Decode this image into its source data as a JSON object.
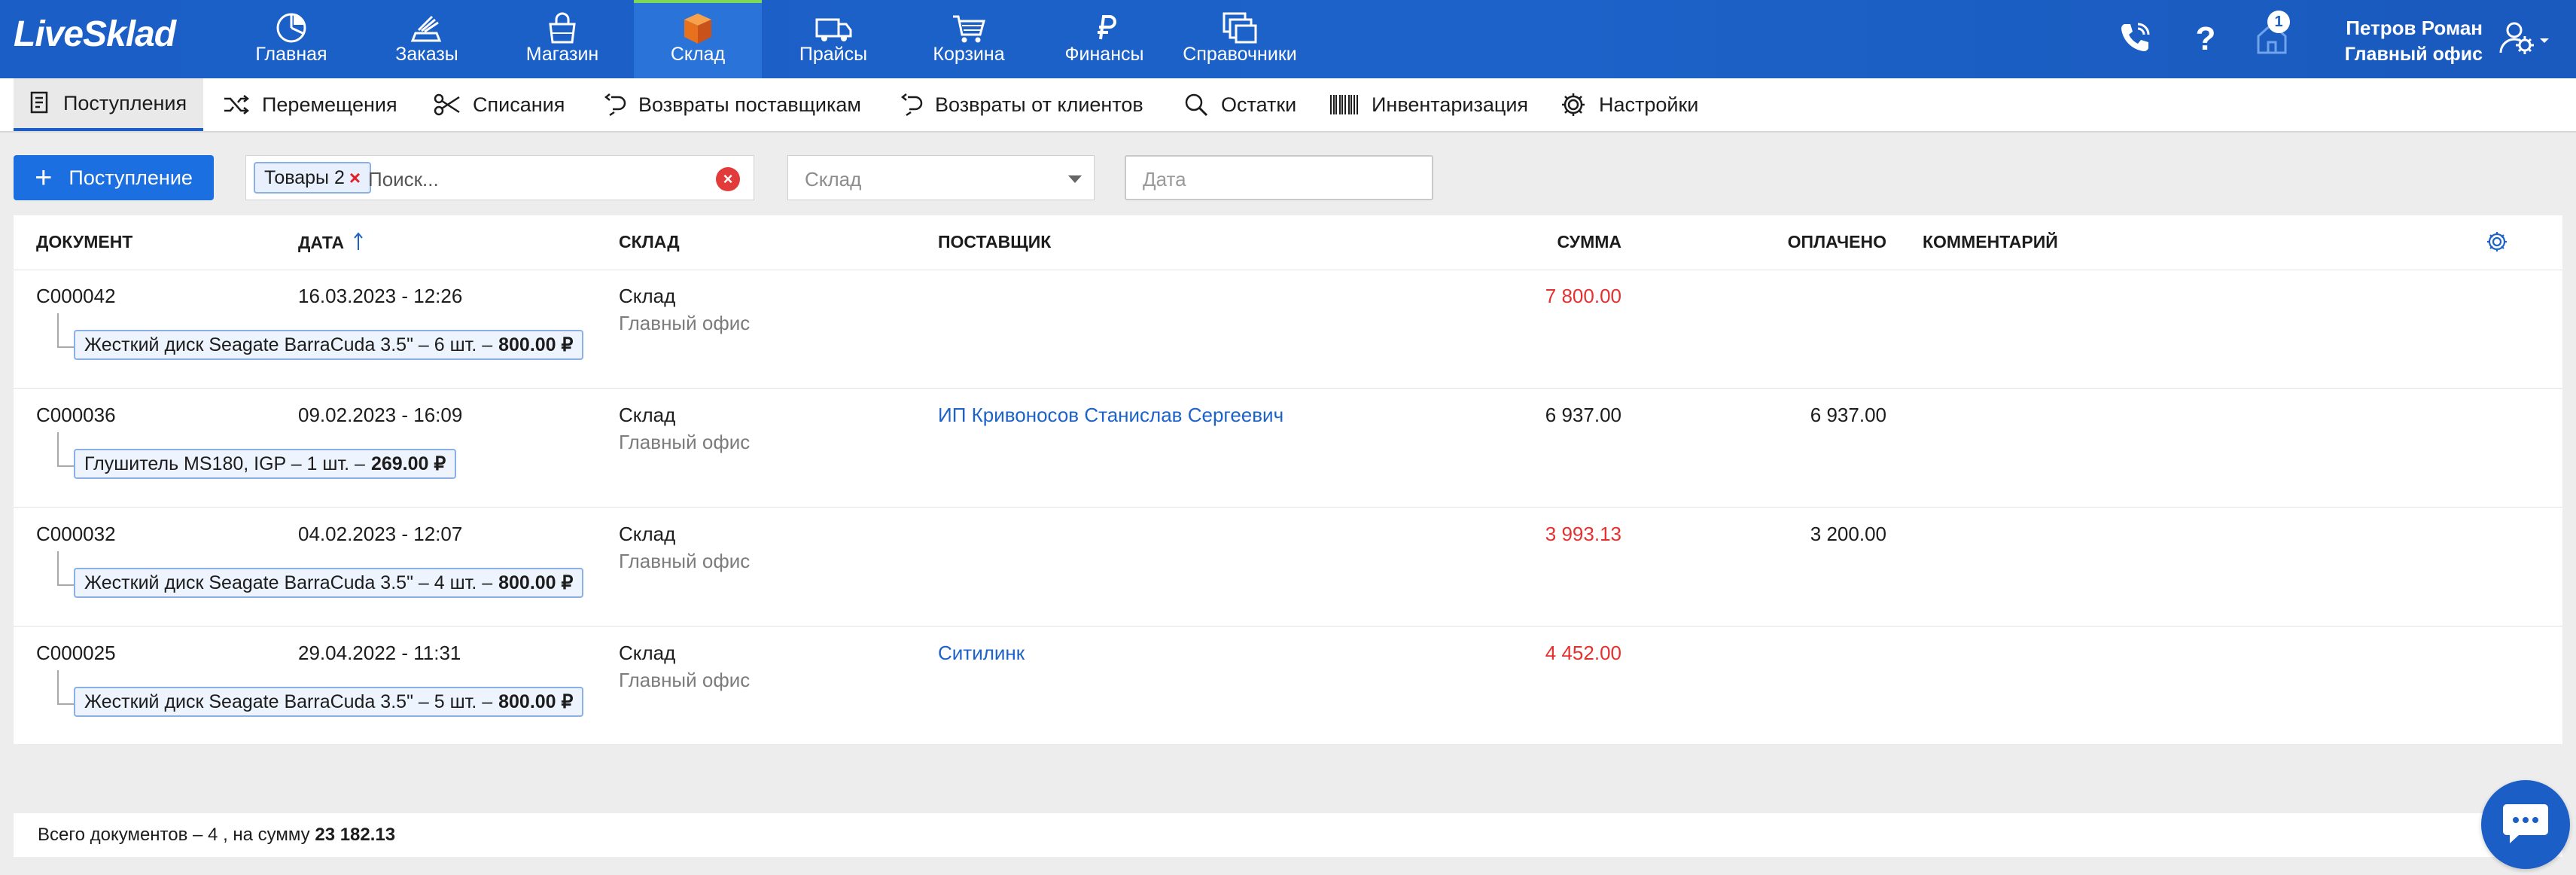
{
  "brand": {
    "logo": "LiveSklad"
  },
  "top_nav": [
    {
      "label": "Главная",
      "icon": "pie-chart-icon"
    },
    {
      "label": "Заказы",
      "icon": "orders-icon"
    },
    {
      "label": "Магазин",
      "icon": "shopping-bag-icon"
    },
    {
      "label": "Склад",
      "icon": "box-icon",
      "active": true
    },
    {
      "label": "Прайсы",
      "icon": "truck-icon"
    },
    {
      "label": "Корзина",
      "icon": "cart-icon"
    },
    {
      "label": "Финансы",
      "icon": "ruble-icon"
    },
    {
      "label": "Справочники",
      "icon": "stacked-windows-icon"
    }
  ],
  "header": {
    "notification_count": "1",
    "user_name": "Петров Роман",
    "user_office": "Главный офис"
  },
  "sub_nav": [
    {
      "label": "Поступления",
      "icon": "document-icon",
      "active": true
    },
    {
      "label": "Перемещения",
      "icon": "shuffle-icon"
    },
    {
      "label": "Списания",
      "icon": "scissors-icon"
    },
    {
      "label": "Возвраты поставщикам",
      "icon": "return-arrow-icon"
    },
    {
      "label": "Возвраты от клиентов",
      "icon": "return-arrow-icon"
    },
    {
      "label": "Остатки",
      "icon": "search-icon"
    },
    {
      "label": "Инвентаризация",
      "icon": "barcode-icon"
    },
    {
      "label": "Настройки",
      "icon": "gear-icon"
    }
  ],
  "toolbar": {
    "add_label": "Поступление",
    "filter_chip": "Товары 2",
    "search_placeholder": "Поиск...",
    "warehouse_placeholder": "Склад",
    "date_placeholder": "Дата"
  },
  "table": {
    "columns": {
      "document": "ДОКУМЕНТ",
      "date": "ДАТА",
      "warehouse": "СКЛАД",
      "supplier": "ПОСТАВЩИК",
      "sum": "СУММА",
      "paid": "ОПЛАЧЕНО",
      "comment": "КОММЕНТАРИЙ"
    },
    "rows": [
      {
        "doc": "C000042",
        "date": "16.03.2023 - 12:26",
        "warehouse": "Склад",
        "office": "Главный офис",
        "supplier": "",
        "sum": "7 800.00",
        "paid": "",
        "item_text": "Жесткий диск Seagate BarraCuda 3.5\" – 6 шт. –",
        "item_price": "800.00 ₽"
      },
      {
        "doc": "C000036",
        "date": "09.02.2023 - 16:09",
        "warehouse": "Склад",
        "office": "Главный офис",
        "supplier": "ИП Кривоносов Станислав Сергеевич",
        "sum": "6 937.00",
        "paid": "6 937.00",
        "item_text": "Глушитель MS180, IGP – 1 шт. –",
        "item_price": "269.00 ₽"
      },
      {
        "doc": "C000032",
        "date": "04.02.2023 - 12:07",
        "warehouse": "Склад",
        "office": "Главный офис",
        "supplier": "",
        "sum": "3 993.13",
        "paid": "3 200.00",
        "item_text": "Жесткий диск Seagate BarraCuda 3.5\" – 4 шт. –",
        "item_price": "800.00 ₽"
      },
      {
        "doc": "C000025",
        "date": "29.04.2022 - 11:31",
        "warehouse": "Склад",
        "office": "Главный офис",
        "supplier": "Ситилинк",
        "sum": "4 452.00",
        "paid": "",
        "item_text": "Жесткий диск Seagate BarraCuda 3.5\" – 5 шт. –",
        "item_price": "800.00 ₽"
      }
    ]
  },
  "footer": {
    "summary_prefix": "Всего документов – 4 , на сумму ",
    "summary_total": "23 182.13"
  },
  "colors": {
    "primary": "#1b5fc6",
    "unpaid": "#e53030",
    "link": "#1c62c8"
  }
}
